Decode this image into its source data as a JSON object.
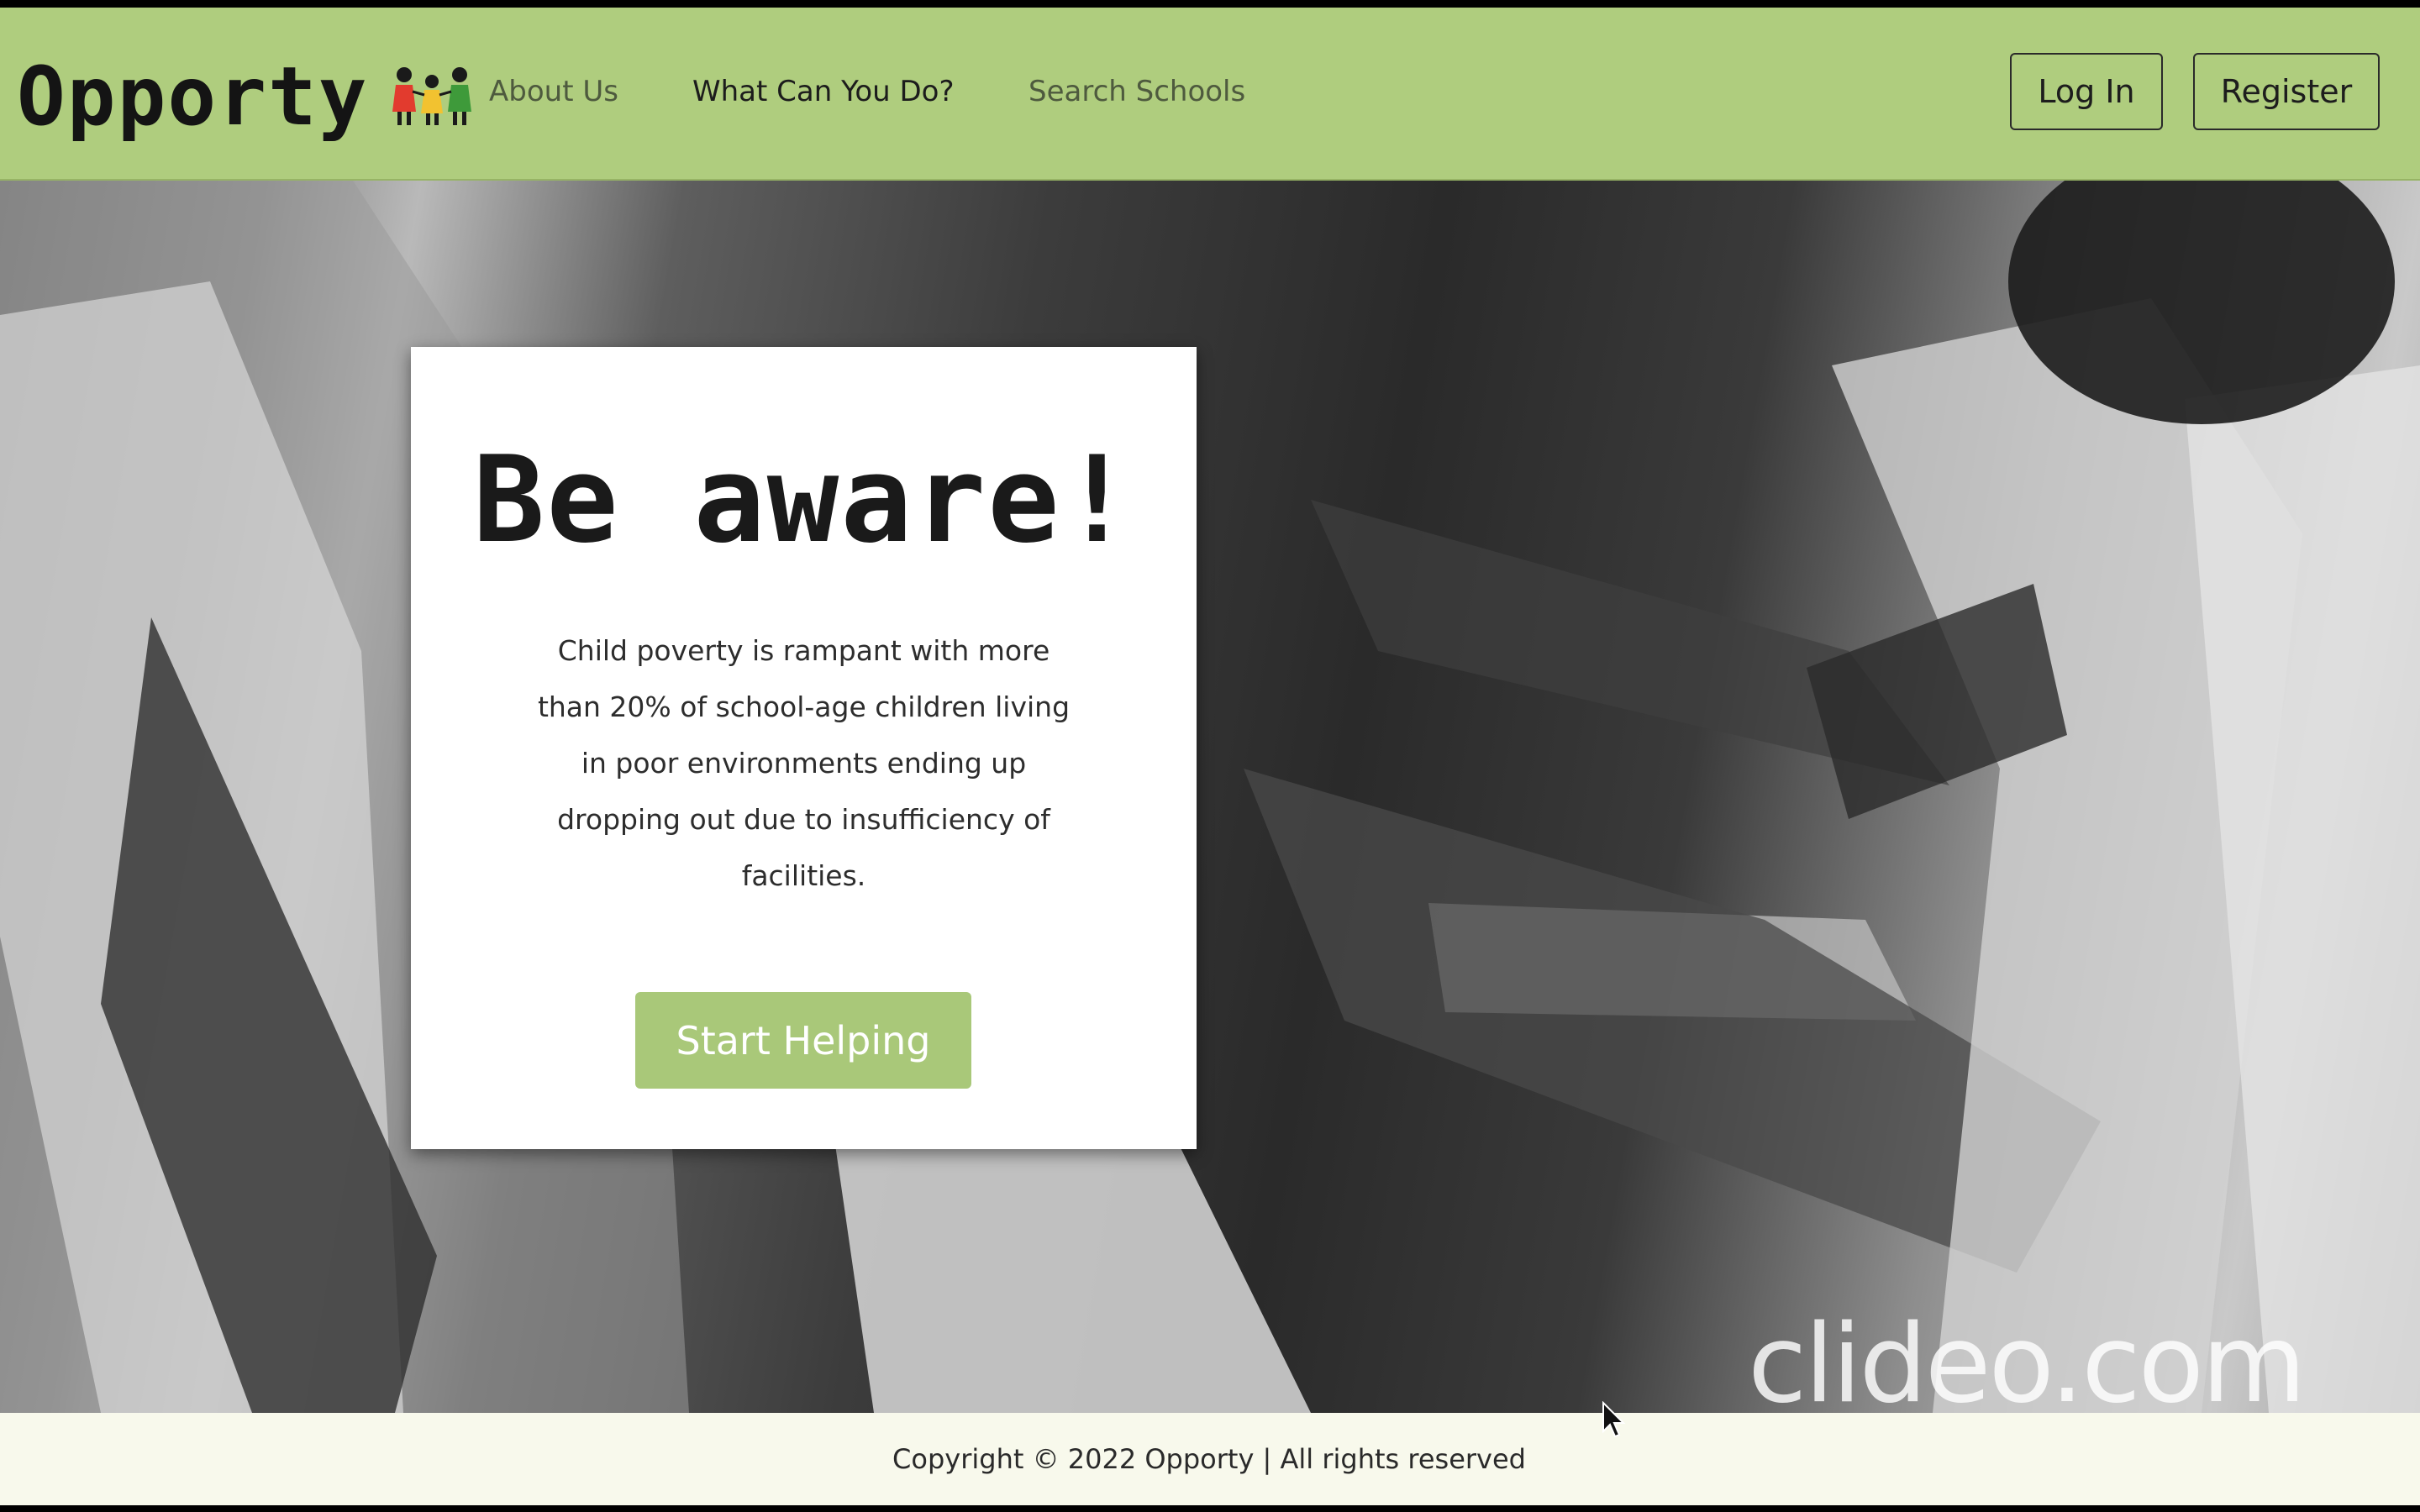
{
  "brand": {
    "name": "Opporty",
    "logo_icon": "children-holding-hands-icon"
  },
  "nav": {
    "items": [
      {
        "label": "About Us"
      },
      {
        "label": "What Can You Do?"
      },
      {
        "label": "Search Schools"
      }
    ],
    "login_label": "Log In",
    "register_label": "Register"
  },
  "hero": {
    "title": "Be aware!",
    "body": "Child poverty is rampant with more than 20% of school-age children living in poor environments ending up dropping out due to insufficiency of facilities.",
    "cta_label": "Start Helping",
    "background": "black-and-white photo of students writing in classroom"
  },
  "watermark": "clideo.com",
  "footer": {
    "text": "Copyright © 2022 Opporty | All rights reserved"
  },
  "colors": {
    "header_bg": "#afcd7e",
    "accent": "#a9c879",
    "footer_bg": "#f8f9ec"
  }
}
